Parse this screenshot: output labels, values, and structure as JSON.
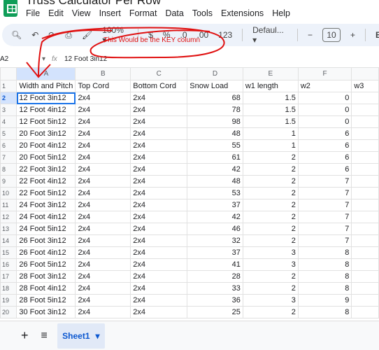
{
  "app": {
    "title": "Truss Calculator Per Row",
    "brand_color": "#0f9d58"
  },
  "menu": [
    "File",
    "Edit",
    "View",
    "Insert",
    "Format",
    "Data",
    "Tools",
    "Extensions",
    "Help"
  ],
  "toolbar": {
    "zoom": "100%",
    "currency": "$",
    "percent": "%",
    "dec_decrease": ".0",
    "dec_increase": ".00",
    "format_more": "123",
    "font": "Defaul...",
    "font_size": "10",
    "bold": "B",
    "italic": "I"
  },
  "formula_bar": {
    "cell_ref": "A2",
    "fx": "fx",
    "value": "12 Foot 3in12"
  },
  "annotation": {
    "text": "This Would be the KEY column",
    "color": "#e01010"
  },
  "columns": [
    "A",
    "B",
    "C",
    "D",
    "E",
    "F",
    ""
  ],
  "rows": [
    [
      "Width and Pitch",
      "Top Cord",
      "Bottom Cord",
      "Snow Load",
      "w1 length",
      "w2",
      "w3"
    ],
    [
      "12 Foot 3in12",
      "2x4",
      "2x4",
      "68",
      "1.5",
      "0",
      ""
    ],
    [
      "12 Foot 4in12",
      "2x4",
      "2x4",
      "78",
      "1.5",
      "0",
      ""
    ],
    [
      "12 Foot 5in12",
      "2x4",
      "2x4",
      "98",
      "1.5",
      "0",
      ""
    ],
    [
      "20 Foot 3in12",
      "2x4",
      "2x4",
      "48",
      "1",
      "6",
      ""
    ],
    [
      "20 Foot 4in12",
      "2x4",
      "2x4",
      "55",
      "1",
      "6",
      ""
    ],
    [
      "20 Foot 5in12",
      "2x4",
      "2x4",
      "61",
      "2",
      "6",
      ""
    ],
    [
      "22 Foot 3in12",
      "2x4",
      "2x4",
      "42",
      "2",
      "6",
      ""
    ],
    [
      "22 Foot 4in12",
      "2x4",
      "2x4",
      "48",
      "2",
      "7",
      ""
    ],
    [
      "22 Foot 5in12",
      "2x4",
      "2x4",
      "53",
      "2",
      "7",
      ""
    ],
    [
      "24 Foot 3in12",
      "2x4",
      "2x4",
      "37",
      "2",
      "7",
      ""
    ],
    [
      "24 Foot 4in12",
      "2x4",
      "2x4",
      "42",
      "2",
      "7",
      ""
    ],
    [
      "24 Foot 5in12",
      "2x4",
      "2x4",
      "46",
      "2",
      "7",
      ""
    ],
    [
      "26 Foot 3in12",
      "2x4",
      "2x4",
      "32",
      "2",
      "7",
      ""
    ],
    [
      "26 Foot 4in12",
      "2x4",
      "2x4",
      "37",
      "3",
      "8",
      ""
    ],
    [
      "26 Foot 5in12",
      "2x4",
      "2x4",
      "41",
      "3",
      "8",
      ""
    ],
    [
      "28 Foot 3in12",
      "2x4",
      "2x4",
      "28",
      "2",
      "8",
      ""
    ],
    [
      "28 Foot 4in12",
      "2x4",
      "2x4",
      "33",
      "2",
      "8",
      ""
    ],
    [
      "28 Foot 5in12",
      "2x4",
      "2x4",
      "36",
      "3",
      "9",
      ""
    ],
    [
      "30 Foot 3in12",
      "2x4",
      "2x4",
      "25",
      "2",
      "8",
      ""
    ]
  ],
  "sheets": {
    "add": "+",
    "list": "≡",
    "active": "Sheet1"
  }
}
